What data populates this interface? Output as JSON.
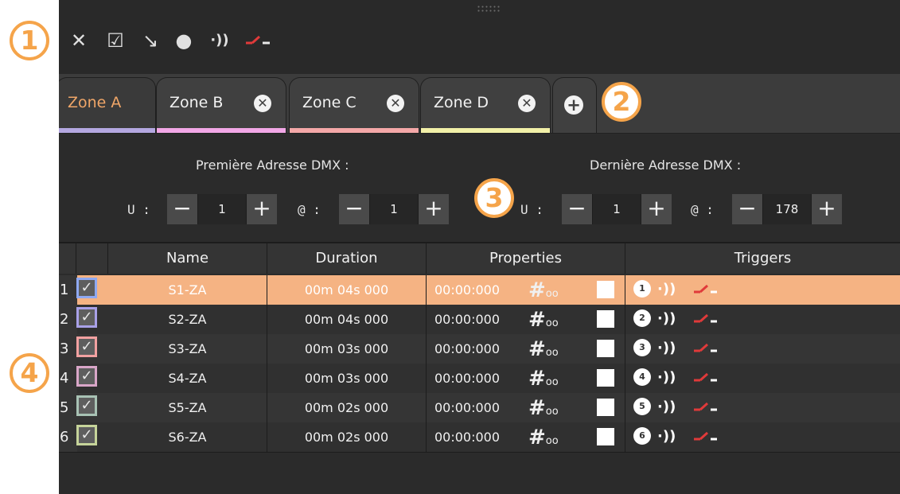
{
  "callouts": [
    "1",
    "2",
    "3",
    "4"
  ],
  "toolbar": {
    "tools": [
      {
        "icon": "close-icon",
        "glyph": "✕"
      },
      {
        "icon": "checkbox-icon",
        "glyph": "☑"
      },
      {
        "icon": "arrow-down-right-icon",
        "glyph": "↘"
      },
      {
        "icon": "record-icon",
        "glyph": "●"
      },
      {
        "icon": "sound-wave-icon",
        "glyph": "·))"
      },
      {
        "icon": "slope-icon",
        "glyph": ""
      }
    ]
  },
  "tabs": [
    {
      "label": "Zone A",
      "color": "#b4a7e0",
      "active": true,
      "closable": false
    },
    {
      "label": "Zone B",
      "color": "#f2a7e6",
      "active": false,
      "closable": true
    },
    {
      "label": "Zone C",
      "color": "#f4a8a8",
      "active": false,
      "closable": true
    },
    {
      "label": "Zone D",
      "color": "#f2f0a8",
      "active": false,
      "closable": true
    }
  ],
  "tab_plus": "+",
  "dmx": {
    "first_title": "Première Adresse DMX :",
    "last_title": "Dernière Adresse DMX :",
    "u_label": "U :",
    "at_label": "@ :",
    "minus": "−",
    "plus": "+",
    "first_u": "1",
    "first_at": "1",
    "last_u": "1",
    "last_at": "178"
  },
  "table": {
    "headers": {
      "name": "Name",
      "duration": "Duration",
      "properties": "Properties",
      "triggers": "Triggers"
    },
    "hash_symbol": "#",
    "hash_suffix": "oo",
    "check_glyph": "✓",
    "wave_glyph": "·))",
    "selected_color": "#f5b383",
    "rows": [
      {
        "num": "1",
        "name": "S1-ZA",
        "duration": "00m 04s 000",
        "time": "00:00:000",
        "trigger": "1",
        "color": "#8fa9f2",
        "selected": true
      },
      {
        "num": "2",
        "name": "S2-ZA",
        "duration": "00m 04s 000",
        "time": "00:00:000",
        "trigger": "2",
        "color": "#a9a1e8",
        "selected": false
      },
      {
        "num": "3",
        "name": "S3-ZA",
        "duration": "00m 03s 000",
        "time": "00:00:000",
        "trigger": "3",
        "color": "#f2a1a1",
        "selected": false
      },
      {
        "num": "4",
        "name": "S4-ZA",
        "duration": "00m 03s 000",
        "time": "00:00:000",
        "trigger": "4",
        "color": "#d9a6c8",
        "selected": false
      },
      {
        "num": "5",
        "name": "S5-ZA",
        "duration": "00m 02s 000",
        "time": "00:00:000",
        "trigger": "5",
        "color": "#a8c2b4",
        "selected": false
      },
      {
        "num": "6",
        "name": "S6-ZA",
        "duration": "00m 02s 000",
        "time": "00:00:000",
        "trigger": "6",
        "color": "#c6d49a",
        "selected": false
      }
    ]
  }
}
